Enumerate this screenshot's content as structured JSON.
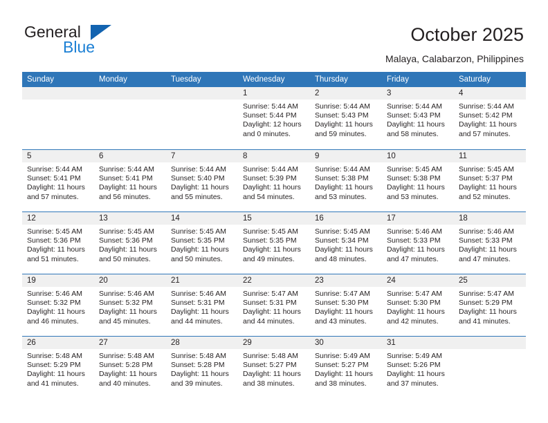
{
  "brand": {
    "line1": "General",
    "line2": "Blue",
    "triangle_icon": "blue-triangle-logo-mark",
    "color_dark": "#231f20",
    "color_blue": "#1b7fd4",
    "triangle_color": "#1263b0"
  },
  "header": {
    "title": "October 2025",
    "subtitle": "Malaya, Calabarzon, Philippines"
  },
  "theme": {
    "header_blue": "#2f76b8",
    "daynum_gray": "#f0f0f0",
    "text": "#231f20"
  },
  "calendar": {
    "weekdays": [
      "Sunday",
      "Monday",
      "Tuesday",
      "Wednesday",
      "Thursday",
      "Friday",
      "Saturday"
    ],
    "weeks": [
      [
        {
          "day": "",
          "sunrise": "",
          "sunset": "",
          "daylight_line1": "",
          "daylight_line2": "",
          "empty": true
        },
        {
          "day": "",
          "sunrise": "",
          "sunset": "",
          "daylight_line1": "",
          "daylight_line2": "",
          "empty": true
        },
        {
          "day": "",
          "sunrise": "",
          "sunset": "",
          "daylight_line1": "",
          "daylight_line2": "",
          "empty": true
        },
        {
          "day": "1",
          "sunrise": "Sunrise: 5:44 AM",
          "sunset": "Sunset: 5:44 PM",
          "daylight_line1": "Daylight: 12 hours",
          "daylight_line2": "and 0 minutes."
        },
        {
          "day": "2",
          "sunrise": "Sunrise: 5:44 AM",
          "sunset": "Sunset: 5:43 PM",
          "daylight_line1": "Daylight: 11 hours",
          "daylight_line2": "and 59 minutes."
        },
        {
          "day": "3",
          "sunrise": "Sunrise: 5:44 AM",
          "sunset": "Sunset: 5:43 PM",
          "daylight_line1": "Daylight: 11 hours",
          "daylight_line2": "and 58 minutes."
        },
        {
          "day": "4",
          "sunrise": "Sunrise: 5:44 AM",
          "sunset": "Sunset: 5:42 PM",
          "daylight_line1": "Daylight: 11 hours",
          "daylight_line2": "and 57 minutes."
        }
      ],
      [
        {
          "day": "5",
          "sunrise": "Sunrise: 5:44 AM",
          "sunset": "Sunset: 5:41 PM",
          "daylight_line1": "Daylight: 11 hours",
          "daylight_line2": "and 57 minutes."
        },
        {
          "day": "6",
          "sunrise": "Sunrise: 5:44 AM",
          "sunset": "Sunset: 5:41 PM",
          "daylight_line1": "Daylight: 11 hours",
          "daylight_line2": "and 56 minutes."
        },
        {
          "day": "7",
          "sunrise": "Sunrise: 5:44 AM",
          "sunset": "Sunset: 5:40 PM",
          "daylight_line1": "Daylight: 11 hours",
          "daylight_line2": "and 55 minutes."
        },
        {
          "day": "8",
          "sunrise": "Sunrise: 5:44 AM",
          "sunset": "Sunset: 5:39 PM",
          "daylight_line1": "Daylight: 11 hours",
          "daylight_line2": "and 54 minutes."
        },
        {
          "day": "9",
          "sunrise": "Sunrise: 5:44 AM",
          "sunset": "Sunset: 5:38 PM",
          "daylight_line1": "Daylight: 11 hours",
          "daylight_line2": "and 53 minutes."
        },
        {
          "day": "10",
          "sunrise": "Sunrise: 5:45 AM",
          "sunset": "Sunset: 5:38 PM",
          "daylight_line1": "Daylight: 11 hours",
          "daylight_line2": "and 53 minutes."
        },
        {
          "day": "11",
          "sunrise": "Sunrise: 5:45 AM",
          "sunset": "Sunset: 5:37 PM",
          "daylight_line1": "Daylight: 11 hours",
          "daylight_line2": "and 52 minutes."
        }
      ],
      [
        {
          "day": "12",
          "sunrise": "Sunrise: 5:45 AM",
          "sunset": "Sunset: 5:36 PM",
          "daylight_line1": "Daylight: 11 hours",
          "daylight_line2": "and 51 minutes."
        },
        {
          "day": "13",
          "sunrise": "Sunrise: 5:45 AM",
          "sunset": "Sunset: 5:36 PM",
          "daylight_line1": "Daylight: 11 hours",
          "daylight_line2": "and 50 minutes."
        },
        {
          "day": "14",
          "sunrise": "Sunrise: 5:45 AM",
          "sunset": "Sunset: 5:35 PM",
          "daylight_line1": "Daylight: 11 hours",
          "daylight_line2": "and 50 minutes."
        },
        {
          "day": "15",
          "sunrise": "Sunrise: 5:45 AM",
          "sunset": "Sunset: 5:35 PM",
          "daylight_line1": "Daylight: 11 hours",
          "daylight_line2": "and 49 minutes."
        },
        {
          "day": "16",
          "sunrise": "Sunrise: 5:45 AM",
          "sunset": "Sunset: 5:34 PM",
          "daylight_line1": "Daylight: 11 hours",
          "daylight_line2": "and 48 minutes."
        },
        {
          "day": "17",
          "sunrise": "Sunrise: 5:46 AM",
          "sunset": "Sunset: 5:33 PM",
          "daylight_line1": "Daylight: 11 hours",
          "daylight_line2": "and 47 minutes."
        },
        {
          "day": "18",
          "sunrise": "Sunrise: 5:46 AM",
          "sunset": "Sunset: 5:33 PM",
          "daylight_line1": "Daylight: 11 hours",
          "daylight_line2": "and 47 minutes."
        }
      ],
      [
        {
          "day": "19",
          "sunrise": "Sunrise: 5:46 AM",
          "sunset": "Sunset: 5:32 PM",
          "daylight_line1": "Daylight: 11 hours",
          "daylight_line2": "and 46 minutes."
        },
        {
          "day": "20",
          "sunrise": "Sunrise: 5:46 AM",
          "sunset": "Sunset: 5:32 PM",
          "daylight_line1": "Daylight: 11 hours",
          "daylight_line2": "and 45 minutes."
        },
        {
          "day": "21",
          "sunrise": "Sunrise: 5:46 AM",
          "sunset": "Sunset: 5:31 PM",
          "daylight_line1": "Daylight: 11 hours",
          "daylight_line2": "and 44 minutes."
        },
        {
          "day": "22",
          "sunrise": "Sunrise: 5:47 AM",
          "sunset": "Sunset: 5:31 PM",
          "daylight_line1": "Daylight: 11 hours",
          "daylight_line2": "and 44 minutes."
        },
        {
          "day": "23",
          "sunrise": "Sunrise: 5:47 AM",
          "sunset": "Sunset: 5:30 PM",
          "daylight_line1": "Daylight: 11 hours",
          "daylight_line2": "and 43 minutes."
        },
        {
          "day": "24",
          "sunrise": "Sunrise: 5:47 AM",
          "sunset": "Sunset: 5:30 PM",
          "daylight_line1": "Daylight: 11 hours",
          "daylight_line2": "and 42 minutes."
        },
        {
          "day": "25",
          "sunrise": "Sunrise: 5:47 AM",
          "sunset": "Sunset: 5:29 PM",
          "daylight_line1": "Daylight: 11 hours",
          "daylight_line2": "and 41 minutes."
        }
      ],
      [
        {
          "day": "26",
          "sunrise": "Sunrise: 5:48 AM",
          "sunset": "Sunset: 5:29 PM",
          "daylight_line1": "Daylight: 11 hours",
          "daylight_line2": "and 41 minutes."
        },
        {
          "day": "27",
          "sunrise": "Sunrise: 5:48 AM",
          "sunset": "Sunset: 5:28 PM",
          "daylight_line1": "Daylight: 11 hours",
          "daylight_line2": "and 40 minutes."
        },
        {
          "day": "28",
          "sunrise": "Sunrise: 5:48 AM",
          "sunset": "Sunset: 5:28 PM",
          "daylight_line1": "Daylight: 11 hours",
          "daylight_line2": "and 39 minutes."
        },
        {
          "day": "29",
          "sunrise": "Sunrise: 5:48 AM",
          "sunset": "Sunset: 5:27 PM",
          "daylight_line1": "Daylight: 11 hours",
          "daylight_line2": "and 38 minutes."
        },
        {
          "day": "30",
          "sunrise": "Sunrise: 5:49 AM",
          "sunset": "Sunset: 5:27 PM",
          "daylight_line1": "Daylight: 11 hours",
          "daylight_line2": "and 38 minutes."
        },
        {
          "day": "31",
          "sunrise": "Sunrise: 5:49 AM",
          "sunset": "Sunset: 5:26 PM",
          "daylight_line1": "Daylight: 11 hours",
          "daylight_line2": "and 37 minutes."
        },
        {
          "day": "",
          "sunrise": "",
          "sunset": "",
          "daylight_line1": "",
          "daylight_line2": "",
          "empty": true
        }
      ]
    ]
  }
}
